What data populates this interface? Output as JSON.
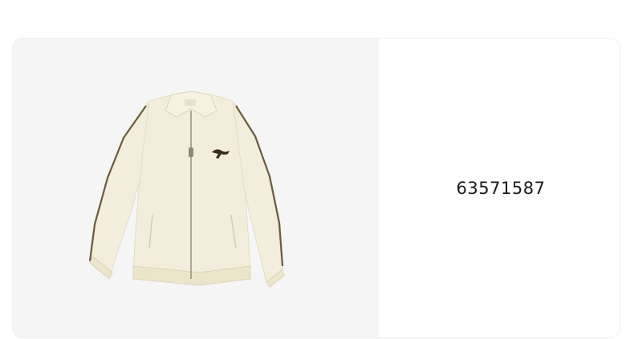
{
  "product": {
    "id": "63571587",
    "image_subject": "cream-track-jacket",
    "colors": {
      "jacket": "#f3eedb",
      "piping": "#6b5b3e",
      "logo": "#3a2a1a",
      "panel_bg": "#f5f5f5"
    }
  }
}
